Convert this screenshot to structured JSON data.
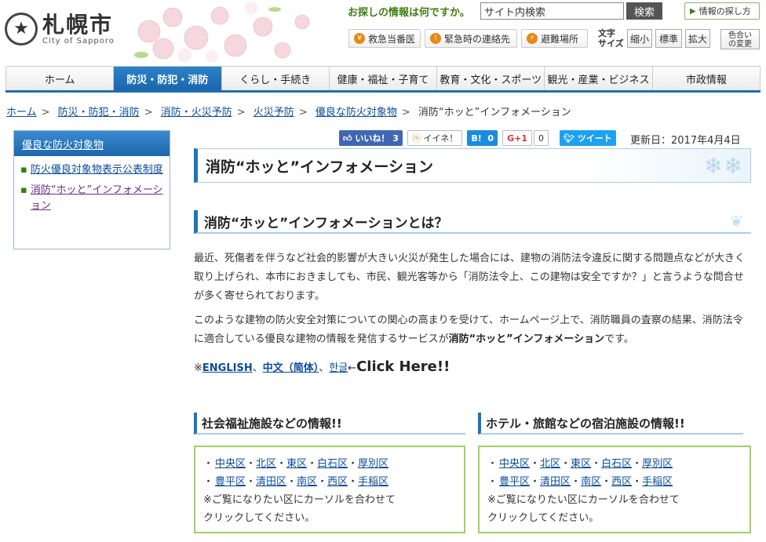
{
  "header": {
    "logo_text": "札幌市",
    "logo_en": "City of Sapporo",
    "search_label": "お探しの情報は何ですか。",
    "search_value": "サイト内検索",
    "search_button": "検索",
    "howto_button": "情報の探し方",
    "quick_links": [
      "救急当番医",
      "緊急時の連絡先",
      "避難場所"
    ],
    "font_size_label_1": "文字",
    "font_size_label_2": "サイズ",
    "font_size_buttons": [
      "縮小",
      "標準",
      "拡大"
    ],
    "color_button_1": "色合い",
    "color_button_2": "の変更"
  },
  "nav": {
    "items": [
      "ホーム",
      "防災・防犯・消防",
      "くらし・手続き",
      "健康・福祉・子育て",
      "教育・文化・スポーツ",
      "観光・産業・ビジネス",
      "市政情報"
    ],
    "active_index": 1
  },
  "breadcrumb": [
    "ホーム",
    "防災・防犯・消防",
    "消防・火災予防",
    "火災予防",
    "優良な防火対象物",
    "消防“ホッと”インフォメーション"
  ],
  "sidebar": {
    "title": "優良な防火対象物",
    "items": [
      "防火優良対象物表示公表制度",
      "消防“ホッと”インフォメーション"
    ]
  },
  "social": {
    "fb_label": "いいね！",
    "fb_count": "3",
    "mixi_label": "イイネ！",
    "hatena_label": "B!",
    "hatena_count": "0",
    "gplus_label": "G+1",
    "gplus_count": "0",
    "tweet_label": "ツイート"
  },
  "updated": "更新日：2017年4月4日",
  "page_title": "消防“ホッと”インフォメーション",
  "about_heading": "消防“ホッと”インフォメーションとは？",
  "para1": "最近、死傷者を伴うなど社会的影響が大きい火災が発生した場合には、建物の消防法令違反に関する問題点などが大きく取り上げられ、本市におきましても、市民、観光客等から「消防法令上、この建物は安全ですか？」と言うような問合せが多く寄せられております。",
  "para2_main": "このような建物の防火安全対策についての関心の高まりを受けて、ホームページ上で、消防職員の査察の結果、消防法令に適合している優良な建物の情報を発信するサービスが",
  "para2_bold": "消防“ホッと”インフォメーション",
  "para2_end": "です。",
  "lang": {
    "prefix": "※",
    "english": "ENGLISH",
    "chinese": "中文（简体）",
    "korean": "한글",
    "sep": "、",
    "arrow": "←",
    "click": "Click Here!!"
  },
  "welfare": {
    "heading": "社会福祉施設などの情報!!",
    "wards_row1": [
      "中央区",
      "北区",
      "東区",
      "白石区",
      "厚別区"
    ],
    "wards_row2": [
      "豊平区",
      "清田区",
      "南区",
      "西区",
      "手稲区"
    ],
    "note1": "※ご覧になりたい区にカーソルを合わせて",
    "note2": "クリックしてください。"
  },
  "hotel": {
    "heading": "ホテル・旅館などの宿泊施設の情報!!",
    "wards_row1": [
      "中央区",
      "北区",
      "東区",
      "白石区",
      "厚別区"
    ],
    "wards_row2": [
      "豊平区",
      "清田区",
      "南区",
      "西区",
      "手稲区"
    ],
    "note1": "※ご覧になりたい区にカーソルを合わせて",
    "note2": "クリックしてください。"
  }
}
